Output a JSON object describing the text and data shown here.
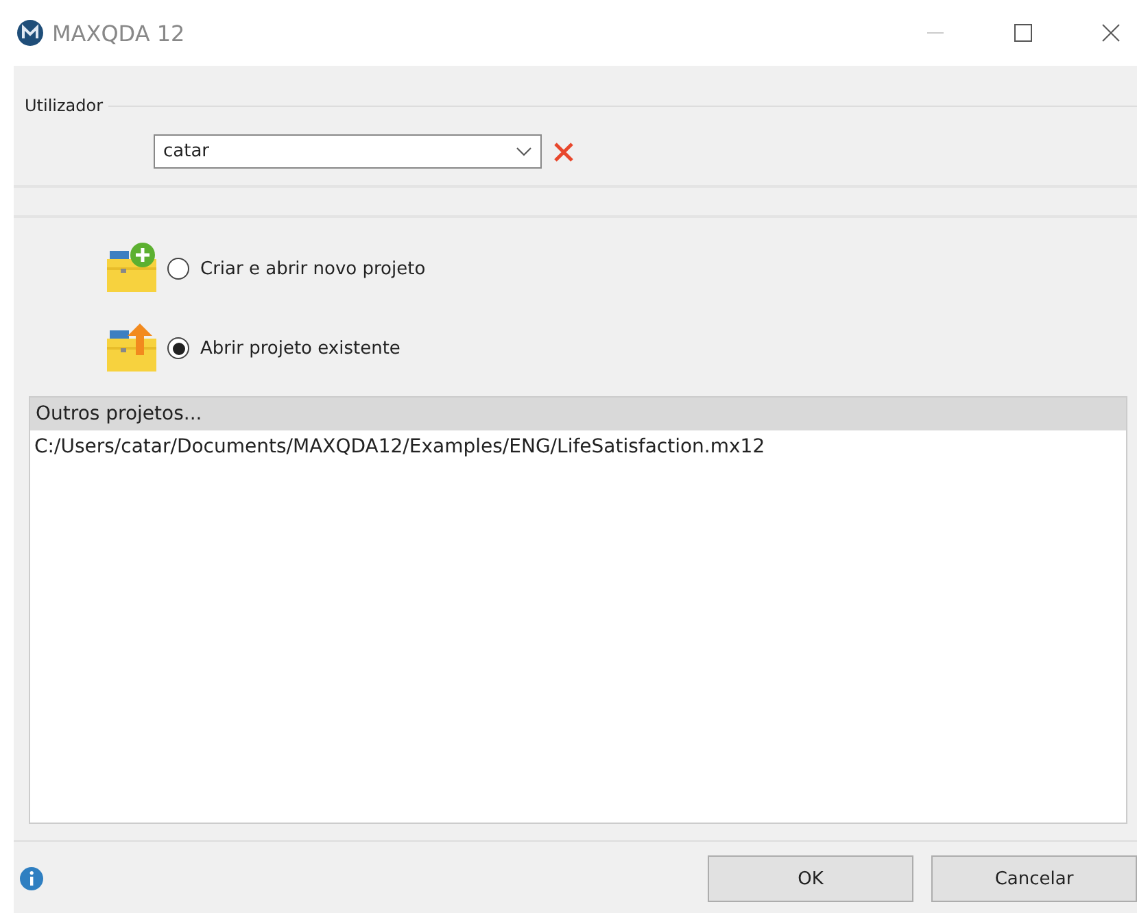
{
  "window": {
    "title": "MAXQDA 12"
  },
  "user_group": {
    "label": "Utilizador",
    "combo": {
      "value": "catar"
    }
  },
  "options": [
    {
      "kind": "new",
      "label": "Criar e abrir novo projeto",
      "selected": false
    },
    {
      "kind": "open",
      "label": "Abrir projeto existente",
      "selected": true
    }
  ],
  "projects_list": {
    "header": "Outros projetos...",
    "items": [
      "C:/Users/catar/Documents/MAXQDA12/Examples/ENG/LifeSatisfaction.mx12"
    ]
  },
  "buttons": [
    "OK",
    "Cancelar"
  ]
}
